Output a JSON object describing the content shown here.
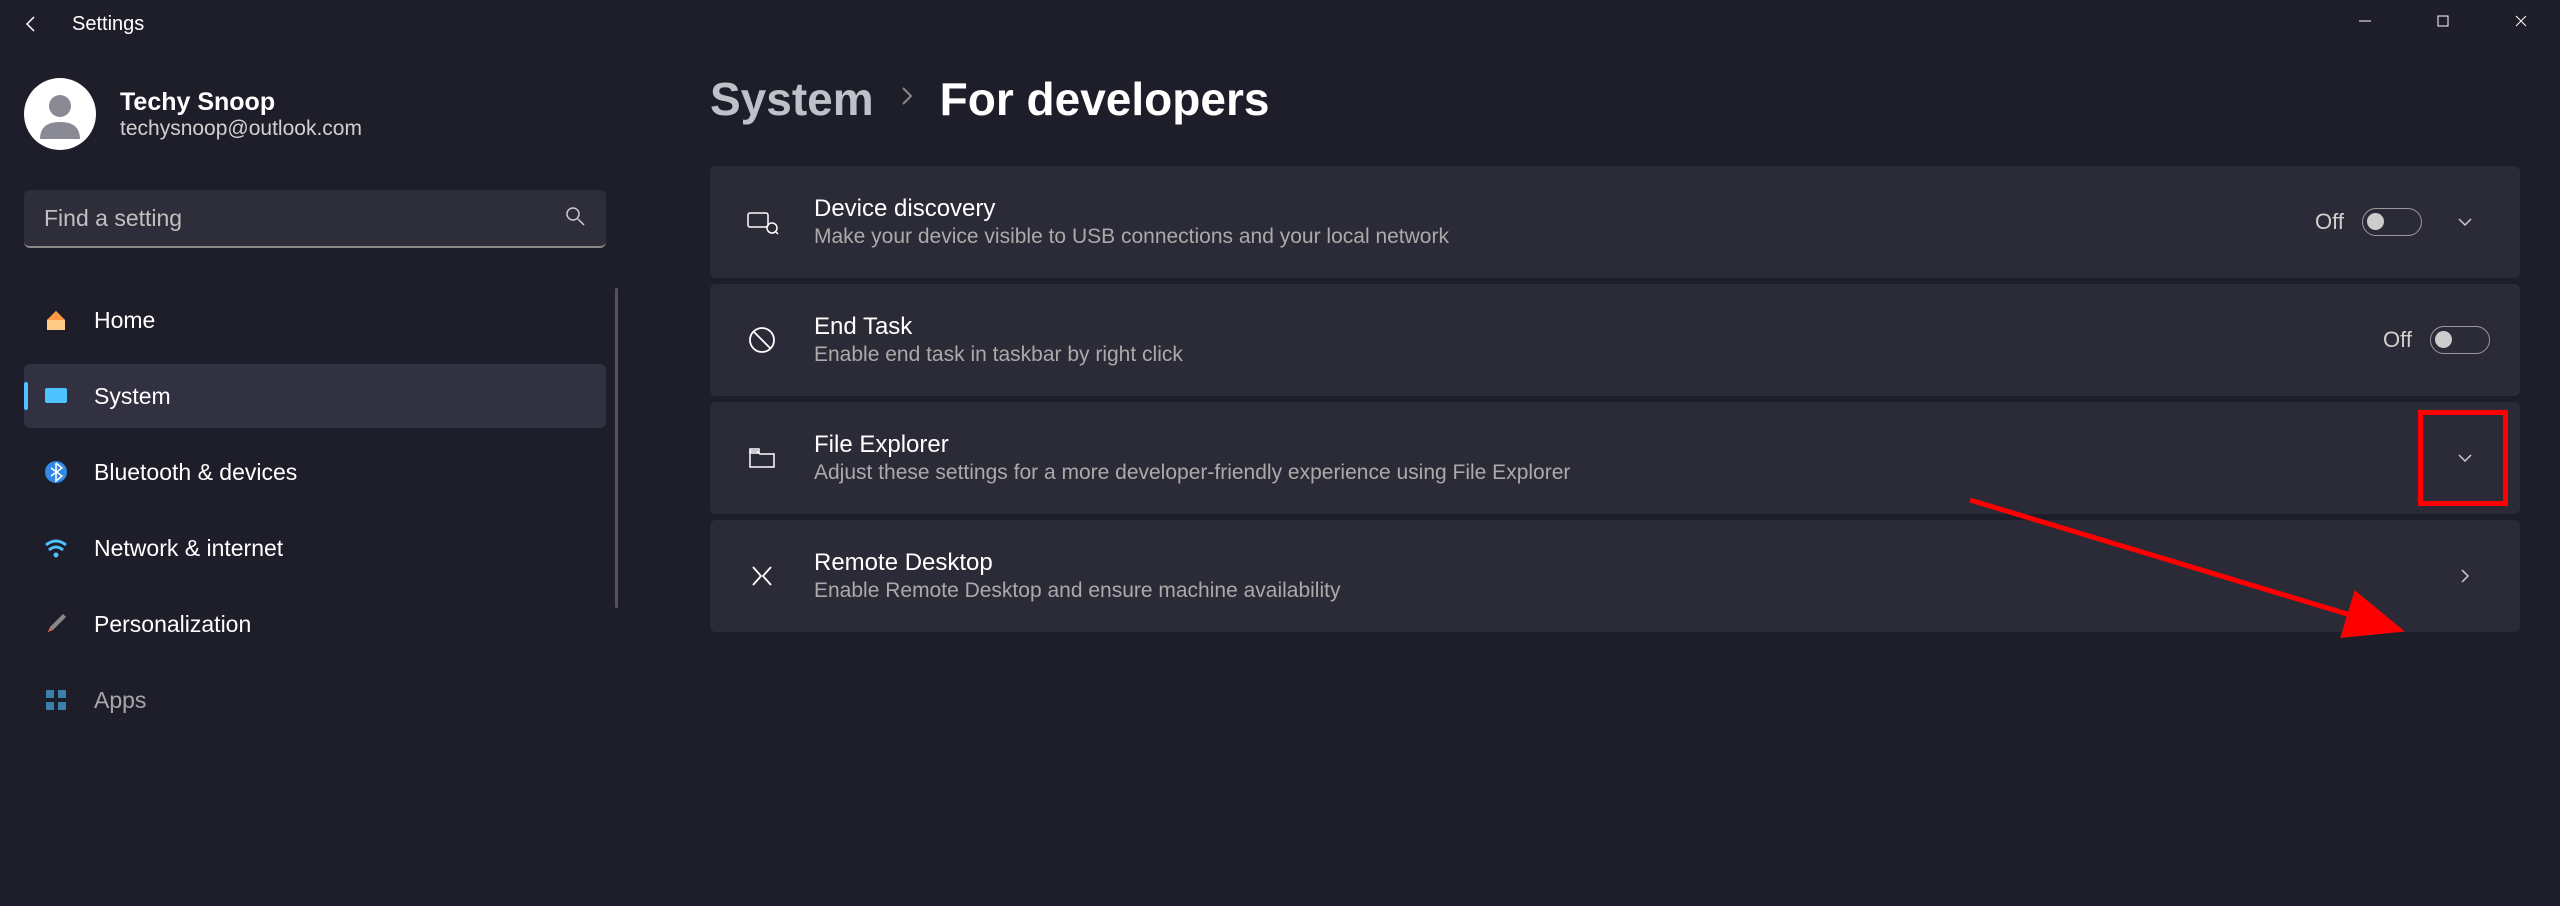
{
  "app": {
    "title": "Settings"
  },
  "user": {
    "name": "Techy Snoop",
    "email": "techysnoop@outlook.com"
  },
  "search": {
    "placeholder": "Find a setting"
  },
  "nav": [
    {
      "label": "Home",
      "key": "home"
    },
    {
      "label": "System",
      "key": "system",
      "active": true
    },
    {
      "label": "Bluetooth & devices",
      "key": "bluetooth"
    },
    {
      "label": "Network & internet",
      "key": "network"
    },
    {
      "label": "Personalization",
      "key": "personalization"
    },
    {
      "label": "Apps",
      "key": "apps"
    }
  ],
  "breadcrumb": {
    "parent": "System",
    "current": "For developers"
  },
  "settings": [
    {
      "title": "Device discovery",
      "desc": "Make your device visible to USB connections and your local network",
      "state": "Off",
      "toggle": true,
      "chevron": "down"
    },
    {
      "title": "End Task",
      "desc": "Enable end task in taskbar by right click",
      "state": "Off",
      "toggle": true,
      "chevron": "none"
    },
    {
      "title": "File Explorer",
      "desc": "Adjust these settings for a more developer-friendly experience using File Explorer",
      "chevron": "down",
      "highlight": true
    },
    {
      "title": "Remote Desktop",
      "desc": "Enable Remote Desktop and ensure machine availability",
      "chevron": "right"
    }
  ]
}
